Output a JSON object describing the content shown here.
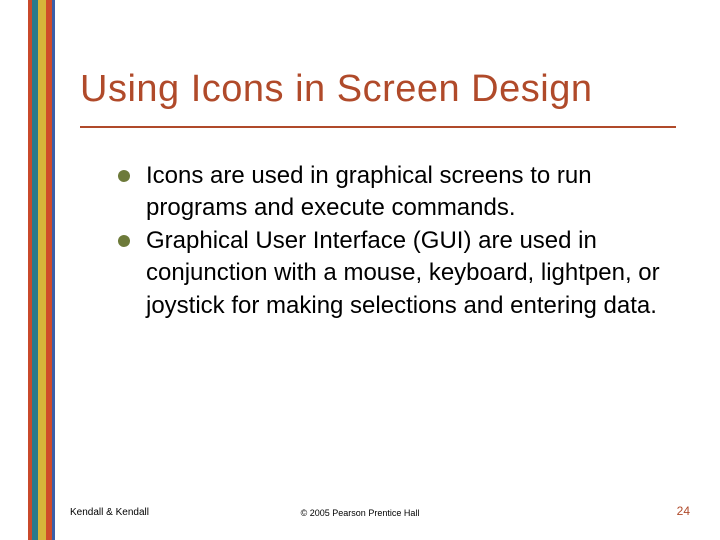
{
  "title": "Using Icons in Screen Design",
  "bullets": [
    "Icons are used in graphical screens to run programs and execute commands.",
    "Graphical User Interface (GUI) are used in conjunction with a mouse, keyboard, lightpen, or joystick for making selections and entering data."
  ],
  "footer": {
    "left": "Kendall & Kendall",
    "center": "© 2005 Pearson Prentice Hall",
    "right": "24"
  }
}
